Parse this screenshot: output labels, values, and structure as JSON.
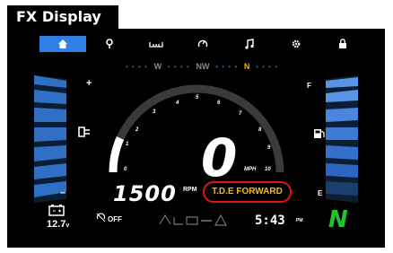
{
  "header": {
    "title": "FX Display"
  },
  "topbar": {
    "items": [
      {
        "icon": "home-icon",
        "active": true
      },
      {
        "icon": "location-pin-icon",
        "active": false
      },
      {
        "icon": "odometer-icon",
        "active": false
      },
      {
        "icon": "tachometer-icon",
        "active": false
      },
      {
        "icon": "music-note-icon",
        "active": false
      },
      {
        "icon": "gear-icon",
        "active": false
      },
      {
        "icon": "lock-icon",
        "active": false
      }
    ]
  },
  "gear_selector": {
    "positions": [
      "W",
      "NW",
      "N"
    ],
    "active": "N"
  },
  "gauge": {
    "ticks": [
      "0",
      "1",
      "2",
      "3",
      "4",
      "5",
      "6",
      "7",
      "8",
      "9",
      "10"
    ],
    "rpm_fraction": 0.15
  },
  "trim": {
    "plus": "+",
    "minus": "–"
  },
  "fuel": {
    "full": "F",
    "empty": "E",
    "level": 0.8
  },
  "speed": {
    "value": "0",
    "unit": "MPH"
  },
  "rpm": {
    "value": "1500",
    "unit": "RPM"
  },
  "mode": {
    "label": "T.D.E FORWARD"
  },
  "battery": {
    "value": "12.7",
    "unit": "v"
  },
  "status": {
    "off_label": "OFF"
  },
  "clock": {
    "time": "5:43",
    "ampm": "PM"
  },
  "gear": {
    "value": "N"
  },
  "colors": {
    "accent": "#2e7fe6",
    "gear_active": "#f0b400",
    "mode_text": "#f0c000",
    "mode_border": "#e11414",
    "neutral": "#23c22f"
  }
}
